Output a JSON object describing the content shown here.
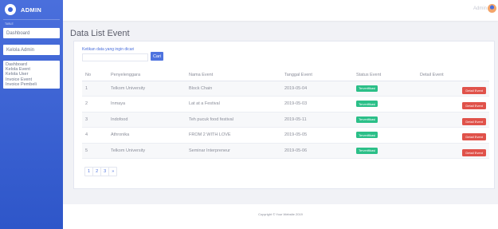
{
  "sidebar": {
    "brand": "ADMIN",
    "small_label": "TABLE",
    "items": [
      {
        "label": "Dashboard"
      },
      {
        "label": "Kelola Admin"
      }
    ],
    "list": [
      "Dashboard",
      "Kelola Event",
      "Kelola User",
      "Invoice Event",
      "Invoice Pembeli"
    ]
  },
  "topbar": {
    "user": "Admin"
  },
  "page": {
    "title": "Data List Event"
  },
  "search": {
    "label": "Ketikan data yang ingin dicari",
    "value": "",
    "button": "Cari"
  },
  "table": {
    "headers": [
      "No",
      "Penyelenggara",
      "Nama Event",
      "Tanggal Event",
      "Status Event",
      "Detail Event"
    ],
    "rows": [
      {
        "no": "1",
        "penyelenggara": "Telkom University",
        "nama": "Block Chain",
        "tanggal": "2019-05-04",
        "status": "Terverifikasi",
        "detail": "Detail Event"
      },
      {
        "no": "2",
        "penyelenggara": "Inmaya",
        "nama": "Lat at a Festival",
        "tanggal": "2019-05-03",
        "status": "Terverifikasi",
        "detail": "Detail Event"
      },
      {
        "no": "3",
        "penyelenggara": "Indofood",
        "nama": "Teh pucuk food festival",
        "tanggal": "2019-05-11",
        "status": "Terverifikasi",
        "detail": "Detail Event"
      },
      {
        "no": "4",
        "penyelenggara": "Athronika",
        "nama": "FROM 2 WITH LOVE",
        "tanggal": "2019-05-05",
        "status": "Terverifikasi",
        "detail": "Detail Event"
      },
      {
        "no": "5",
        "penyelenggara": "Telkom University",
        "nama": "Seminar Interpreneur",
        "tanggal": "2019-05-06",
        "status": "Terverifikasi",
        "detail": "Detail Event"
      }
    ]
  },
  "pagination": [
    "1",
    "2",
    "3",
    "»"
  ],
  "footer": {
    "text": "Copyright © Your Website 2019"
  },
  "colors": {
    "sidebar": "#3b62d6",
    "primary": "#4e73df",
    "success": "#2bbf88",
    "danger": "#e0524a"
  }
}
